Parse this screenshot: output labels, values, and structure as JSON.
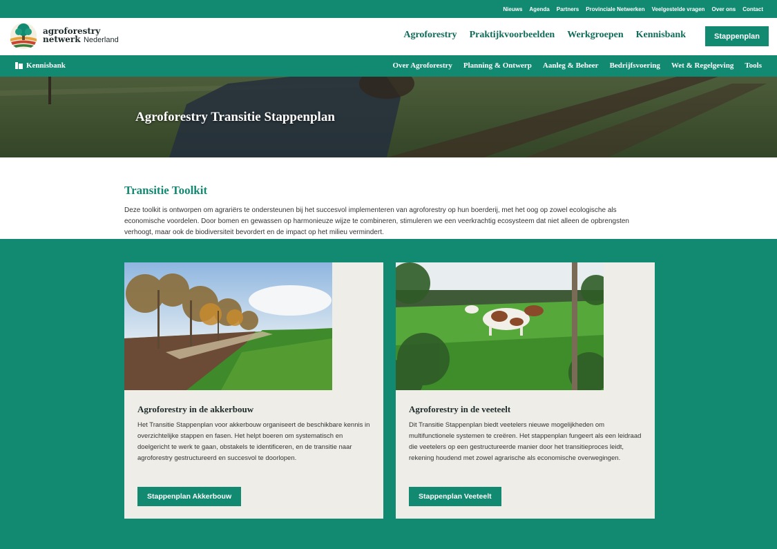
{
  "topbar": {
    "links": [
      "Nieuws",
      "Agenda",
      "Partners",
      "Provinciale Netwerken",
      "Veelgestelde vragen",
      "Over ons",
      "Contact"
    ]
  },
  "logo": {
    "line1": "agroforestry",
    "line2": "netwerk",
    "line3": "Nederland"
  },
  "mainnav": {
    "items": [
      "Agroforestry",
      "Praktijkvoorbeelden",
      "Werkgroepen",
      "Kennisbank"
    ],
    "cta": "Stappenplan"
  },
  "subnav": {
    "section": "Kennisbank",
    "items": [
      "Over Agroforestry",
      "Planning & Ontwerp",
      "Aanleg & Beheer",
      "Bedrijfsvoering",
      "Wet & Regelgeving",
      "Tools"
    ]
  },
  "hero": {
    "title": "Agroforestry Transitie Stappenplan"
  },
  "intro": {
    "title": "Transitie Toolkit",
    "text": "Deze toolkit is ontworpen om agrariërs te ondersteunen bij het succesvol implementeren van agroforestry op hun boerderij, met het oog op zowel ecologische als economische voordelen. Door bomen en gewassen op harmonieuze wijze te combineren, stimuleren we een veerkrachtig ecosysteem dat niet alleen de opbrengsten verhoogt, maar ook de biodiversiteit bevordert en de impact op het milieu vermindert."
  },
  "cards": [
    {
      "title": "Agroforestry in de akkerbouw",
      "text": "Het Transitie Stappenplan voor akkerbouw organiseert de beschikbare kennis in overzichtelijke stappen en fasen. Het helpt boeren om systematisch en doelgericht te werk te gaan, obstakels te identificeren, en de transitie naar agroforestry gestructureerd en succesvol te doorlopen.",
      "button": "Stappenplan Akkerbouw"
    },
    {
      "title": "Agroforestry in de veeteelt",
      "text": "Dit Transitie Stappenplan biedt veetelers nieuwe mogelijkheden om multifunctionele systemen te creëren. Het stappenplan fungeert als een leidraad die veetelers op een gestructureerde manier door het transitieproces leidt, rekening houdend met zowel agrarische als economische overwegingen.",
      "button": "Stappenplan Veeteelt"
    }
  ],
  "colors": {
    "brand_green": "#128a71",
    "card_bg": "#eeede8",
    "dark_text": "#1d2b2b"
  }
}
